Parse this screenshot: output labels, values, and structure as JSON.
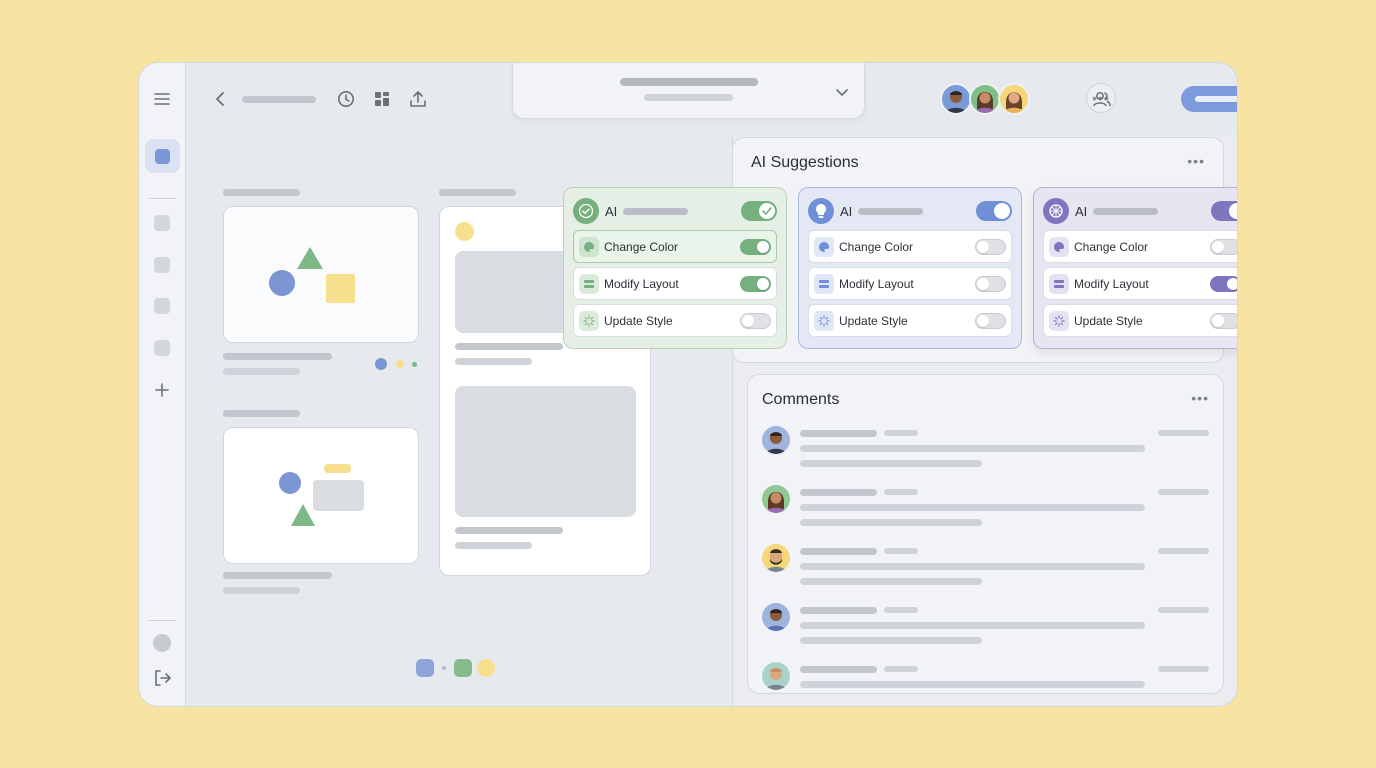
{
  "ai_suggestions": {
    "title": "AI Suggestions",
    "cards": [
      {
        "theme": "green",
        "label": "AI",
        "enabled": true,
        "accent": "#76b07f",
        "items": [
          {
            "label": "Change Color",
            "on": true,
            "selected": true
          },
          {
            "label": "Modify Layout",
            "on": true,
            "selected": false
          },
          {
            "label": "Update Style",
            "on": false,
            "selected": false
          }
        ]
      },
      {
        "theme": "blue",
        "label": "AI",
        "enabled": true,
        "accent": "#6f8fd8",
        "items": [
          {
            "label": "Change Color",
            "on": false,
            "selected": false
          },
          {
            "label": "Modify Layout",
            "on": false,
            "selected": false
          },
          {
            "label": "Update Style",
            "on": false,
            "selected": false
          }
        ]
      },
      {
        "theme": "purple",
        "label": "AI",
        "enabled": true,
        "accent": "#7f76c0",
        "items": [
          {
            "label": "Change Color",
            "on": false,
            "selected": false
          },
          {
            "label": "Modify Layout",
            "on": true,
            "selected": false
          },
          {
            "label": "Update Style",
            "on": false,
            "selected": false
          }
        ]
      }
    ]
  },
  "comments": {
    "title": "Comments"
  },
  "icons": {
    "menu": "hamburger-icon",
    "back": "chevron-left-icon",
    "history": "clock-icon",
    "layout": "grid-icon",
    "share": "upload-icon",
    "dropdown": "chevron-down-icon",
    "collaborators": "users-icon",
    "add": "plus-icon",
    "logout": "logout-icon"
  },
  "colors": {
    "background": "#f8e4a2",
    "accent_blue": "#7c9bdc",
    "accent_green": "#76b07f",
    "accent_yellow": "#f6e08d",
    "accent_purple": "#7f76c0"
  }
}
